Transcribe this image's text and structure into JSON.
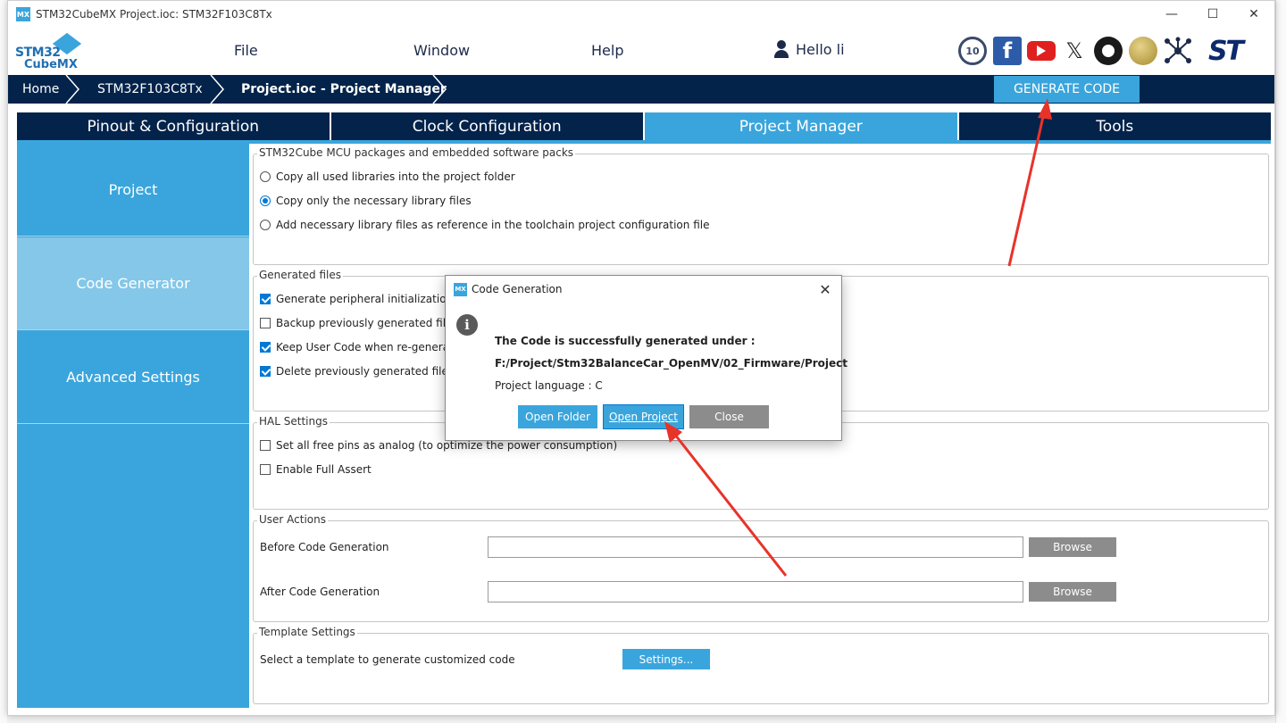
{
  "window": {
    "title": "STM32CubeMX Project.ioc: STM32F103C8Tx",
    "app_icon": "MX",
    "minimize": "—",
    "maximize": "☐",
    "close": "✕"
  },
  "logo": {
    "line1": "STM32",
    "line2": "CubeMX"
  },
  "menu": {
    "file": "File",
    "window": "Window",
    "help": "Help"
  },
  "user": {
    "greeting": "Hello li"
  },
  "social": {
    "badge10": "10",
    "facebook": "f",
    "x": "𝕏",
    "st": "ST"
  },
  "breadcrumb": {
    "home": "Home",
    "device": "STM32F103C8Tx",
    "current": "Project.ioc - Project Manager"
  },
  "generate_button": "GENERATE CODE",
  "tabs": [
    {
      "label": "Pinout & Configuration"
    },
    {
      "label": "Clock Configuration"
    },
    {
      "label": "Project Manager"
    },
    {
      "label": "Tools"
    }
  ],
  "sidebar": {
    "items": [
      {
        "label": "Project"
      },
      {
        "label": "Code Generator"
      },
      {
        "label": "Advanced Settings"
      }
    ]
  },
  "packs": {
    "title": "STM32Cube MCU packages and embedded software packs",
    "options": [
      {
        "label": "Copy all used libraries into the project folder",
        "selected": false
      },
      {
        "label": "Copy only the necessary library files",
        "selected": true
      },
      {
        "label": "Add necessary library files as reference in the toolchain project configuration file",
        "selected": false
      }
    ]
  },
  "generated": {
    "title": "Generated files",
    "options": [
      {
        "label": "Generate peripheral initialization a",
        "checked": true
      },
      {
        "label": "Backup previously generated files",
        "checked": false
      },
      {
        "label": "Keep User Code when re-generat",
        "checked": true
      },
      {
        "label": "Delete previously generated files v",
        "checked": true
      }
    ]
  },
  "hal": {
    "title": "HAL Settings",
    "options": [
      {
        "label": "Set all free pins as analog (to optimize the power consumption)",
        "checked": false
      },
      {
        "label": "Enable Full Assert",
        "checked": false
      }
    ]
  },
  "user_actions": {
    "title": "User Actions",
    "before_label": "Before Code Generation",
    "after_label": "After Code Generation",
    "before_value": "",
    "after_value": "",
    "browse": "Browse"
  },
  "template": {
    "title": "Template Settings",
    "label": "Select a template to generate customized code",
    "button": "Settings..."
  },
  "dialog": {
    "title": "Code Generation",
    "line1": "The Code is successfully generated under :",
    "line2": "F:/Project/Stm32BalanceCar_OpenMV/02_Firmware/Project",
    "line3": "Project language : C",
    "open_folder": "Open Folder",
    "open_project": "Open Project",
    "close": "Close",
    "info_glyph": "i",
    "close_glyph": "✕"
  },
  "colors": {
    "navy": "#03234b",
    "accent": "#3aa5dc",
    "sidebar_active": "#84c7e9",
    "annotation": "#e8332a",
    "disabled_button": "#8c8c8c"
  }
}
